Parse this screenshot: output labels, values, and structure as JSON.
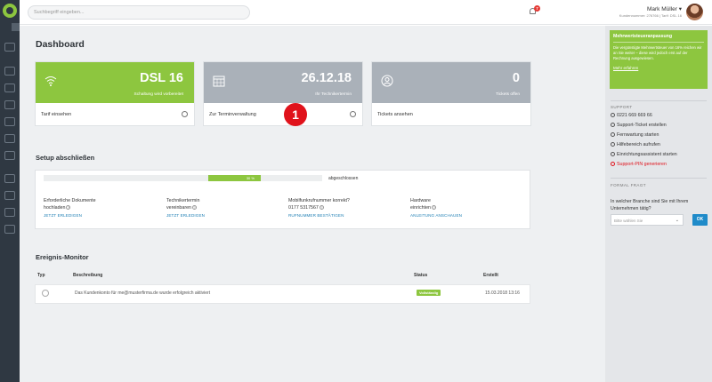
{
  "search": {
    "placeholder": "Suchbegriff eingeben..."
  },
  "notifications": {
    "count": "7"
  },
  "user": {
    "name": "Mark Müller",
    "details": "Kundennummer: 276766 | Tarif: DSL 16"
  },
  "page_title": "Dashboard",
  "cards": [
    {
      "value": "DSL 16",
      "caption": "Schaltung wird vorbereitet",
      "link": "Tarif einsehen",
      "color": "#8dc63f",
      "icon": "wifi-icon"
    },
    {
      "value": "26.12.18",
      "caption": "Ihr Techniker­termin",
      "link": "Zur Terminverwaltung",
      "color": "#aab1b9",
      "icon": "calendar-icon"
    },
    {
      "value": "0",
      "caption": "Tickets offen",
      "link": "Tickets ansehen",
      "color": "#aab1b9",
      "icon": "person-icon"
    }
  ],
  "marker": {
    "label": "1"
  },
  "setup": {
    "title": "Setup abschließen",
    "progress_percent": 30,
    "progress_label": "30 %",
    "progress_caption": "abgeschlossen",
    "items": [
      {
        "line1": "Erforderliche Dokumente",
        "line2": "hochladen",
        "action": "JETZT ERLEDIGEN"
      },
      {
        "line1": "Technikertermin",
        "line2": "vereinbaren",
        "action": "JETZT ERLEDIGEN"
      },
      {
        "line1": "Mobilfunkrufnummer korrekt?",
        "line2": "0177 5317567",
        "action": "RUFNUMMER BESTÄTIGEN"
      },
      {
        "line1": "Hardware",
        "line2": "einrichten",
        "action": "ANLEITUNG ANSCHAUEN"
      }
    ]
  },
  "events": {
    "title": "Ereignis-Monitor",
    "columns": {
      "type": "Typ",
      "description": "Beschreibung",
      "status": "Status",
      "created": "Erstellt"
    },
    "rows": [
      {
        "description": "Das Kundenkonto für me@musterfirma.de wurde erfolgreich aktiviert",
        "status": "Vollständig",
        "created": "15.03.2018 13:16"
      }
    ]
  },
  "promo": {
    "title": "Mehrwertsteueranpassung",
    "text": "Die vergünstigte Mehrwertsteuer von 16% reichen wir an Sie weiter – diese wird jedoch erst auf der Rechnung ausgewiesen.",
    "link": "Mehr erfahren"
  },
  "support": {
    "title": "SUPPORT",
    "phone": "0221 669 669 66",
    "items": [
      {
        "label": "Support-Ticket erstellen"
      },
      {
        "label": "Fernwartung starten"
      },
      {
        "label": "Hilfebereich aufrufen"
      },
      {
        "label": "Einrichtungsassistent starten"
      },
      {
        "label": "Support-PIN generieren"
      }
    ]
  },
  "question": {
    "title": "FORMAL FRAGT",
    "text": "In welcher Branche sind Sie mit Ihrem Unternehmen tätig?",
    "select_placeholder": "Bitte wählen Sie",
    "ok_label": "OK"
  }
}
